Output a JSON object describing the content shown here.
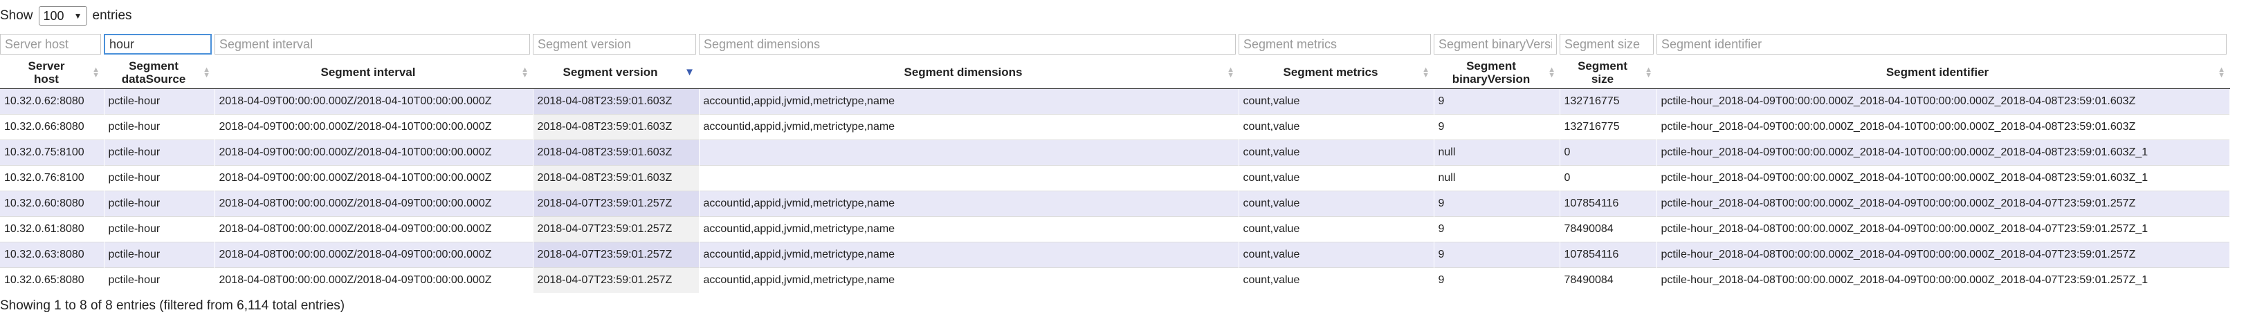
{
  "length_control": {
    "prefix": "Show",
    "value": "100",
    "suffix": "entries"
  },
  "filters": [
    {
      "placeholder": "Server host",
      "value": ""
    },
    {
      "placeholder": "Segment dataSource",
      "value": "hour"
    },
    {
      "placeholder": "Segment interval",
      "value": ""
    },
    {
      "placeholder": "Segment version",
      "value": ""
    },
    {
      "placeholder": "Segment dimensions",
      "value": ""
    },
    {
      "placeholder": "Segment metrics",
      "value": ""
    },
    {
      "placeholder": "Segment binaryVersion",
      "value": ""
    },
    {
      "placeholder": "Segment size",
      "value": ""
    },
    {
      "placeholder": "Segment identifier",
      "value": ""
    }
  ],
  "columns": [
    {
      "line1": "Server",
      "line2": "host"
    },
    {
      "line1": "Segment",
      "line2": "dataSource"
    },
    {
      "line1": "Segment interval",
      "line2": ""
    },
    {
      "line1": "Segment version",
      "line2": ""
    },
    {
      "line1": "Segment dimensions",
      "line2": ""
    },
    {
      "line1": "Segment metrics",
      "line2": ""
    },
    {
      "line1": "Segment",
      "line2": "binaryVersion"
    },
    {
      "line1": "Segment",
      "line2": "size"
    },
    {
      "line1": "Segment identifier",
      "line2": ""
    }
  ],
  "rows": [
    [
      "10.32.0.62:8080",
      "pctile-hour",
      "2018-04-09T00:00:00.000Z/2018-04-10T00:00:00.000Z",
      "2018-04-08T23:59:01.603Z",
      "accountid,appid,jvmid,metrictype,name",
      "count,value",
      "9",
      "132716775",
      "pctile-hour_2018-04-09T00:00:00.000Z_2018-04-10T00:00:00.000Z_2018-04-08T23:59:01.603Z"
    ],
    [
      "10.32.0.66:8080",
      "pctile-hour",
      "2018-04-09T00:00:00.000Z/2018-04-10T00:00:00.000Z",
      "2018-04-08T23:59:01.603Z",
      "accountid,appid,jvmid,metrictype,name",
      "count,value",
      "9",
      "132716775",
      "pctile-hour_2018-04-09T00:00:00.000Z_2018-04-10T00:00:00.000Z_2018-04-08T23:59:01.603Z"
    ],
    [
      "10.32.0.75:8100",
      "pctile-hour",
      "2018-04-09T00:00:00.000Z/2018-04-10T00:00:00.000Z",
      "2018-04-08T23:59:01.603Z",
      "",
      "count,value",
      "null",
      "0",
      "pctile-hour_2018-04-09T00:00:00.000Z_2018-04-10T00:00:00.000Z_2018-04-08T23:59:01.603Z_1"
    ],
    [
      "10.32.0.76:8100",
      "pctile-hour",
      "2018-04-09T00:00:00.000Z/2018-04-10T00:00:00.000Z",
      "2018-04-08T23:59:01.603Z",
      "",
      "count,value",
      "null",
      "0",
      "pctile-hour_2018-04-09T00:00:00.000Z_2018-04-10T00:00:00.000Z_2018-04-08T23:59:01.603Z_1"
    ],
    [
      "10.32.0.60:8080",
      "pctile-hour",
      "2018-04-08T00:00:00.000Z/2018-04-09T00:00:00.000Z",
      "2018-04-07T23:59:01.257Z",
      "accountid,appid,jvmid,metrictype,name",
      "count,value",
      "9",
      "107854116",
      "pctile-hour_2018-04-08T00:00:00.000Z_2018-04-09T00:00:00.000Z_2018-04-07T23:59:01.257Z"
    ],
    [
      "10.32.0.61:8080",
      "pctile-hour",
      "2018-04-08T00:00:00.000Z/2018-04-09T00:00:00.000Z",
      "2018-04-07T23:59:01.257Z",
      "accountid,appid,jvmid,metrictype,name",
      "count,value",
      "9",
      "78490084",
      "pctile-hour_2018-04-08T00:00:00.000Z_2018-04-09T00:00:00.000Z_2018-04-07T23:59:01.257Z_1"
    ],
    [
      "10.32.0.63:8080",
      "pctile-hour",
      "2018-04-08T00:00:00.000Z/2018-04-09T00:00:00.000Z",
      "2018-04-07T23:59:01.257Z",
      "accountid,appid,jvmid,metrictype,name",
      "count,value",
      "9",
      "107854116",
      "pctile-hour_2018-04-08T00:00:00.000Z_2018-04-09T00:00:00.000Z_2018-04-07T23:59:01.257Z"
    ],
    [
      "10.32.0.65:8080",
      "pctile-hour",
      "2018-04-08T00:00:00.000Z/2018-04-09T00:00:00.000Z",
      "2018-04-07T23:59:01.257Z",
      "accountid,appid,jvmid,metrictype,name",
      "count,value",
      "9",
      "78490084",
      "pctile-hour_2018-04-08T00:00:00.000Z_2018-04-09T00:00:00.000Z_2018-04-07T23:59:01.257Z_1"
    ]
  ],
  "info": "Showing 1 to 8 of 8 entries (filtered from 6,114 total entries)",
  "icons": {
    "sort_both": "sort-icon",
    "sort_desc": "sort-desc-icon",
    "caret": "chevron-down-icon"
  },
  "colors": {
    "odd_row": "#e8e8f7",
    "sort_active": "#3b5db0",
    "focus": "#4a90d9"
  }
}
